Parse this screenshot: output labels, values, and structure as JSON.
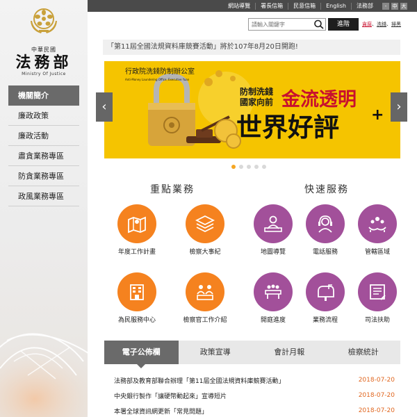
{
  "logo": {
    "small": "中華民國",
    "main": "法務部",
    "en": "Ministry Of Justice"
  },
  "sidebar": {
    "items": [
      {
        "label": "機關簡介",
        "active": true
      },
      {
        "label": "廉政政策"
      },
      {
        "label": "廉政活動"
      },
      {
        "label": "肅貪業務專區"
      },
      {
        "label": "防貪業務專區"
      },
      {
        "label": "政風業務專區"
      }
    ]
  },
  "topbar": {
    "links": [
      "網站導覽",
      "署長信箱",
      "民意信箱",
      "English",
      "法務部"
    ],
    "font_sizes": [
      "-",
      "中",
      "大"
    ]
  },
  "search": {
    "placeholder": "請輸入關鍵字",
    "advanced_label": "進階",
    "hot_words": [
      "貪腐",
      "洗錢",
      "掃黑"
    ]
  },
  "marquee": {
    "text": "「第11屆全國法規資料庫競賽活動」將於107年8月20日開跑!"
  },
  "banner": {
    "agency_cn": "行政院洗錢防制辦公室",
    "agency_en": "Anti-Money Laundering Office, Executive Yuan",
    "line1": "防制洗錢",
    "line2": "國家向前",
    "headline1": "金流透明",
    "headline2": "世界好評",
    "plus": "+",
    "colors": {
      "bg": "#f5c400",
      "accent": "#c8102e"
    }
  },
  "carousel": {
    "active_index": 0,
    "count": 5
  },
  "key_services": {
    "title": "重點業務",
    "items": [
      {
        "label": "年度工作計畫",
        "icon": "map-icon"
      },
      {
        "label": "檢察大事紀",
        "icon": "layers-icon"
      },
      {
        "label": "為民服務中心",
        "icon": "building-icon"
      },
      {
        "label": "檢察官工作介紹",
        "icon": "people-icon"
      }
    ]
  },
  "quick_services": {
    "title": "快速服務",
    "items": [
      {
        "label": "地圖導覽",
        "icon": "reception-icon"
      },
      {
        "label": "電話服務",
        "icon": "headset-icon"
      },
      {
        "label": "管轄區域",
        "icon": "hands-group-icon"
      },
      {
        "label": "開庭進度",
        "icon": "meeting-icon"
      },
      {
        "label": "業務流程",
        "icon": "mailbox-icon"
      },
      {
        "label": "司法扶助",
        "icon": "document-icon"
      }
    ]
  },
  "tabs": {
    "items": [
      {
        "label": "電子公佈欄",
        "active": true
      },
      {
        "label": "政策宣導"
      },
      {
        "label": "會計月報"
      },
      {
        "label": "檢察統計"
      }
    ]
  },
  "news": [
    {
      "title": "法務部及教育部聯合辦理「第11屆全國法規資料庫競賽活動」",
      "date": "2018-07-20"
    },
    {
      "title": "中央銀行製作「讓硬幣動起來」宣導短片",
      "date": "2018-07-20"
    },
    {
      "title": "本署全球資訊網更新「常見問題」",
      "date": "2018-07-20"
    }
  ]
}
